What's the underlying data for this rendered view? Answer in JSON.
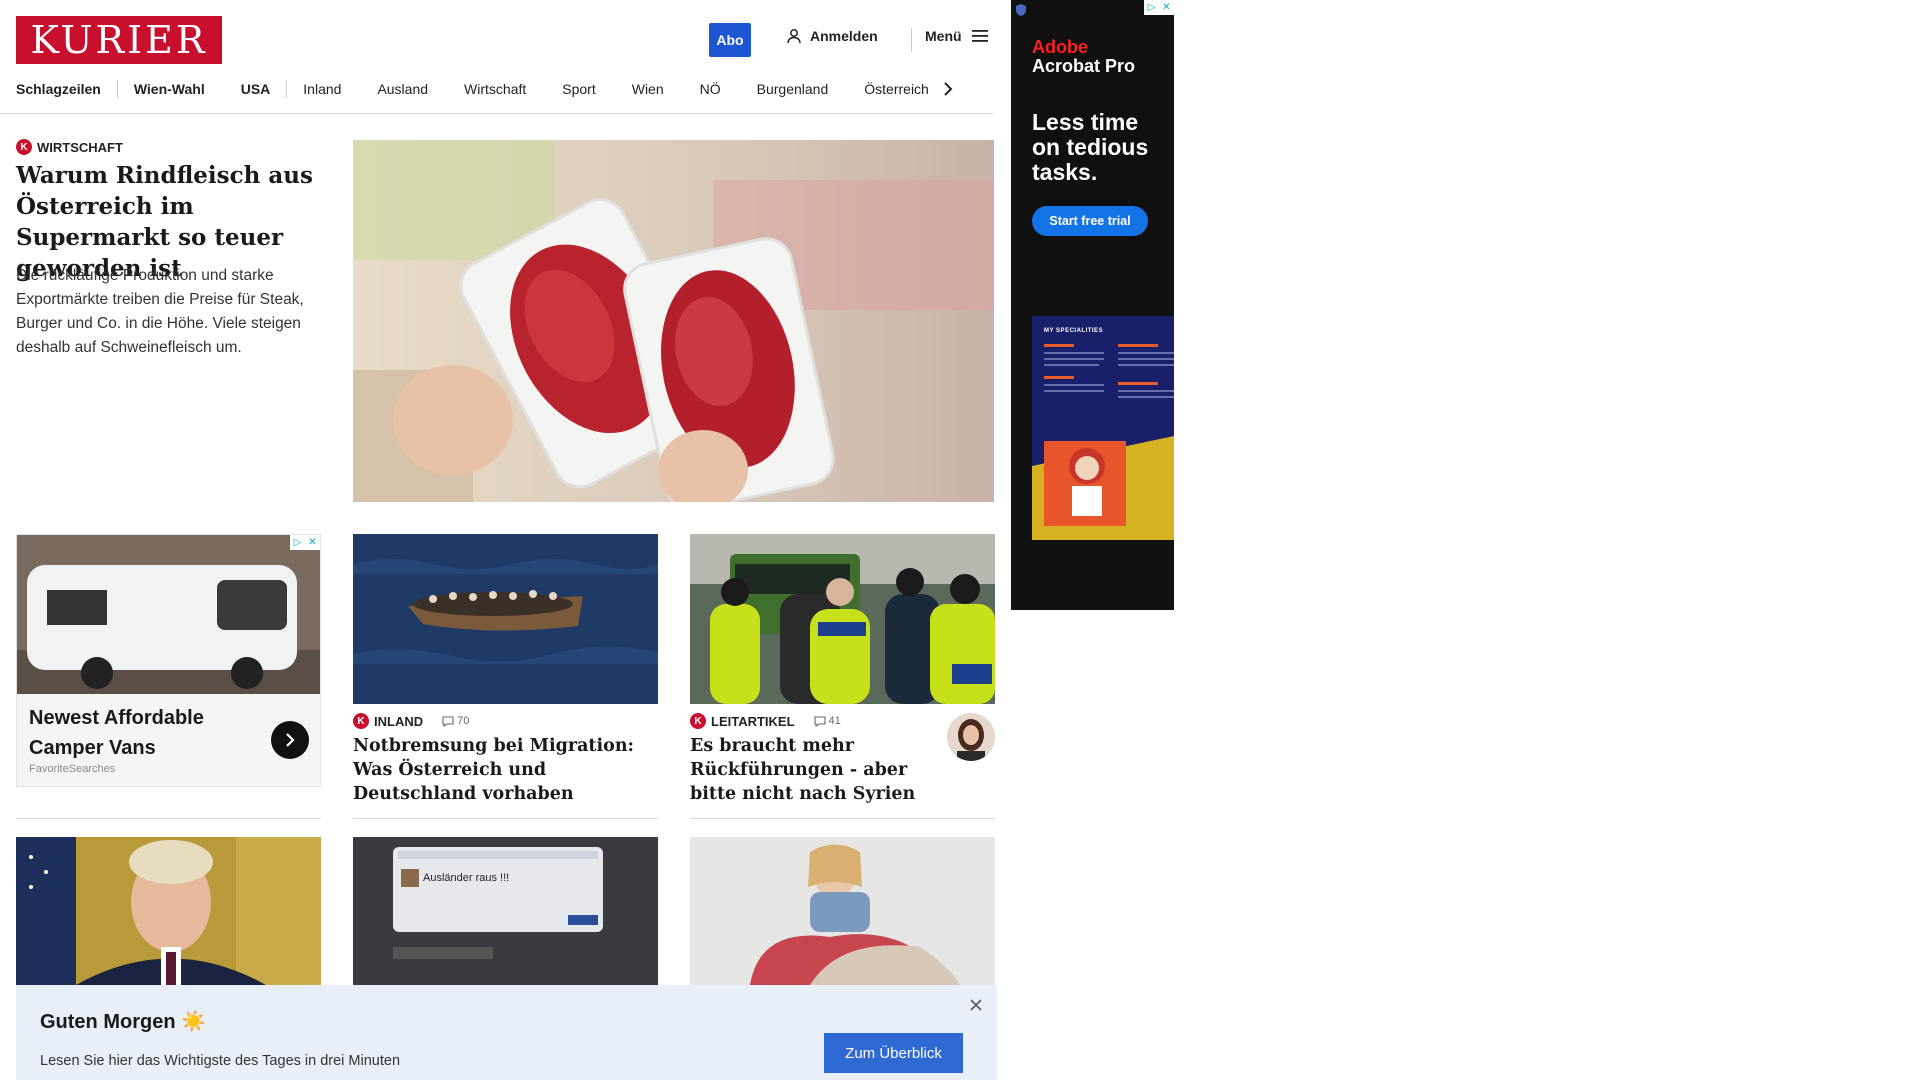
{
  "header": {
    "logo_text": "KURIER",
    "abo_label": "Abo",
    "login_label": "Anmelden",
    "menu_label": "Menü",
    "colors": {
      "brand": "#c8102e",
      "accent": "#1d55d3"
    }
  },
  "nav": {
    "items": [
      "Schlagzeilen",
      "Wien-Wahl",
      "USA",
      "Inland",
      "Ausland",
      "Wirtschaft",
      "Sport",
      "Wien",
      "NÖ",
      "Burgenland",
      "Österreich"
    ]
  },
  "lead": {
    "category": "WIRTSCHAFT",
    "title": "Warum Rindfleisch aus Österreich im Supermarkt so teuer geworden ist",
    "text": "Die rückläufige Produktion und starke Exportmärkte treiben die Preise für Steak, Burger und Co. in die Höhe. Viele steigen deshalb auf Schweinefleisch um."
  },
  "ad_card": {
    "title": "Newest Affordable Camper Vans",
    "source": "FavoriteSearches"
  },
  "teasers": [
    {
      "category": "INLAND",
      "comments": "70",
      "title": "Notbremsung bei Migration: Was Österreich und Deutschland vorhaben"
    },
    {
      "category": "LEITARTIKEL",
      "comments": "41",
      "title": "Es braucht mehr Rückführungen - aber bitte nicht nach Syrien"
    }
  ],
  "row3": {
    "screen_text": "Ausländer raus !!!"
  },
  "banner": {
    "title": "Guten Morgen ☀️",
    "text": "Lesen Sie hier das Wichtigste des Tages in drei Minuten",
    "button_label": "Zum Überblick"
  },
  "side_ad": {
    "brand_line1": "Adobe",
    "brand_line2": "Acrobat Pro",
    "headline": "Less time on tedious tasks.",
    "cta_label": "Start free trial",
    "promo_label": "MY SPECIALITIES"
  }
}
